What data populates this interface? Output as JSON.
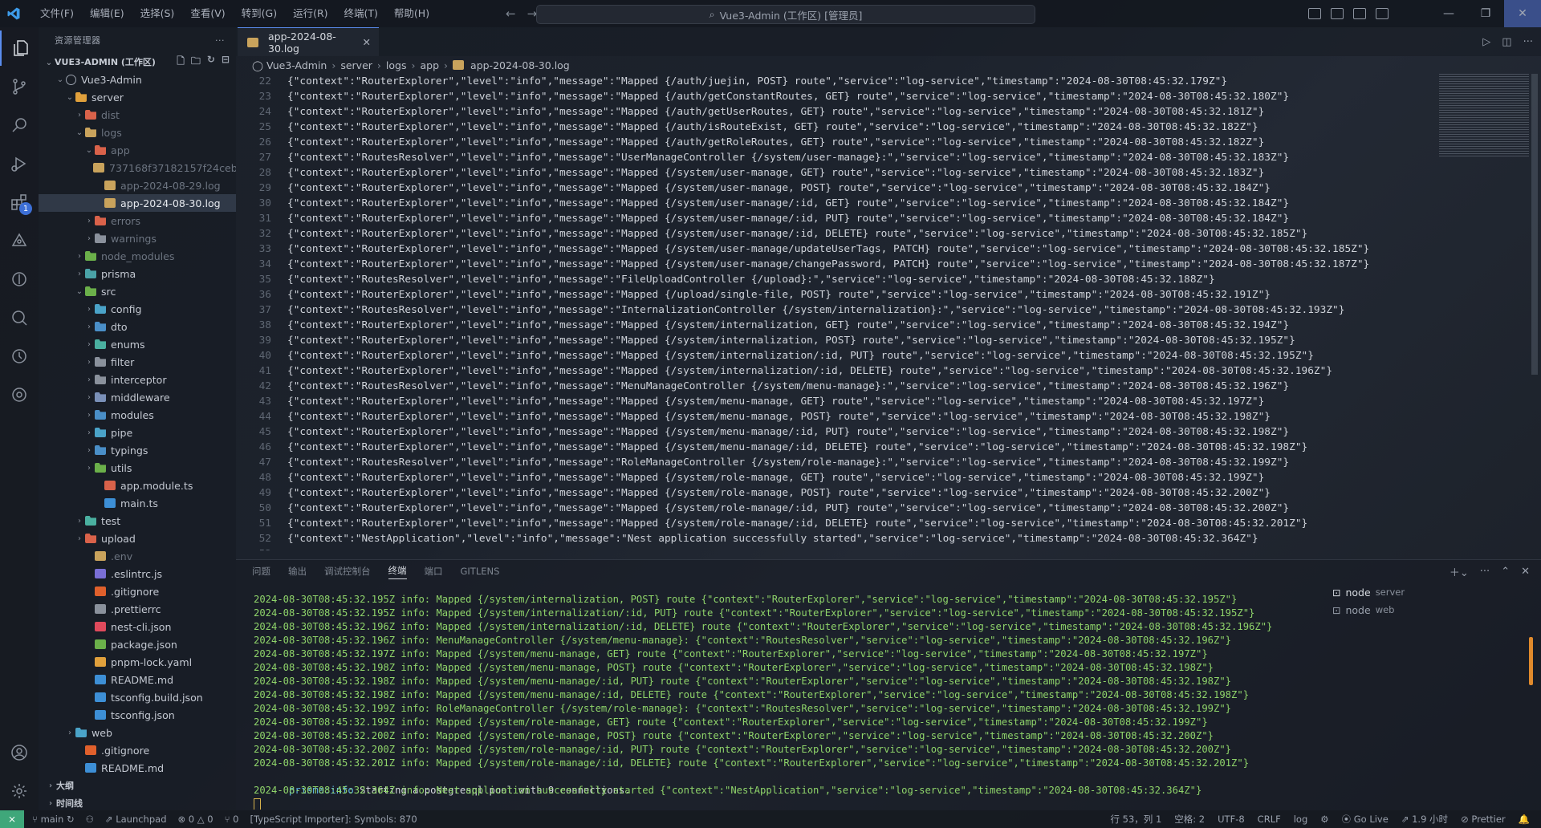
{
  "titlebar": {
    "menu": [
      "文件(F)",
      "编辑(E)",
      "选择(S)",
      "查看(V)",
      "转到(G)",
      "运行(R)",
      "终端(T)",
      "帮助(H)"
    ],
    "search": "Vue3-Admin (工作区) [管理员]"
  },
  "activity": {
    "extensions_badge": "1"
  },
  "sidebar": {
    "title": "资源管理器",
    "workspace": "VUE3-ADMIN (工作区)",
    "tree": [
      {
        "label": "Vue3-Admin",
        "indent": 1,
        "chev": "⌄",
        "icon": "circle",
        "color": "#9aa1ad",
        "dim": false,
        "sel": false
      },
      {
        "label": "server",
        "indent": 2,
        "chev": "⌄",
        "icon": "folder",
        "color": "#e0a03c",
        "dim": false,
        "sel": false
      },
      {
        "label": "dist",
        "indent": 3,
        "chev": "›",
        "icon": "folder",
        "color": "#d9624a",
        "dim": true,
        "sel": false
      },
      {
        "label": "logs",
        "indent": 3,
        "chev": "⌄",
        "icon": "folder",
        "color": "#c9a35c",
        "dim": true,
        "sel": false
      },
      {
        "label": "app",
        "indent": 4,
        "chev": "⌄",
        "icon": "folder",
        "color": "#d9624a",
        "dim": true,
        "sel": false
      },
      {
        "label": "737168f37182157f24ceb...",
        "indent": 5,
        "chev": "",
        "icon": "json",
        "color": "#c9a35c",
        "dim": true,
        "sel": false
      },
      {
        "label": "app-2024-08-29.log",
        "indent": 5,
        "chev": "",
        "icon": "log",
        "color": "#c9a35c",
        "dim": true,
        "sel": false
      },
      {
        "label": "app-2024-08-30.log",
        "indent": 5,
        "chev": "",
        "icon": "log",
        "color": "#c9a35c",
        "dim": false,
        "sel": true
      },
      {
        "label": "errors",
        "indent": 4,
        "chev": "›",
        "icon": "folder",
        "color": "#d9624a",
        "dim": true,
        "sel": false
      },
      {
        "label": "warnings",
        "indent": 4,
        "chev": "›",
        "icon": "folder",
        "color": "#8a919c",
        "dim": true,
        "sel": false
      },
      {
        "label": "node_modules",
        "indent": 3,
        "chev": "›",
        "icon": "folder",
        "color": "#6bb04a",
        "dim": true,
        "sel": false
      },
      {
        "label": "prisma",
        "indent": 3,
        "chev": "›",
        "icon": "folder",
        "color": "#4aa3a8",
        "dim": false,
        "sel": false
      },
      {
        "label": "src",
        "indent": 3,
        "chev": "⌄",
        "icon": "folder",
        "color": "#6bb04a",
        "dim": false,
        "sel": false
      },
      {
        "label": "config",
        "indent": 4,
        "chev": "›",
        "icon": "folder",
        "color": "#4aa3c8",
        "dim": false,
        "sel": false
      },
      {
        "label": "dto",
        "indent": 4,
        "chev": "›",
        "icon": "folder",
        "color": "#4a8fc8",
        "dim": false,
        "sel": false
      },
      {
        "label": "enums",
        "indent": 4,
        "chev": "›",
        "icon": "folder",
        "color": "#4ab0a0",
        "dim": false,
        "sel": false
      },
      {
        "label": "filter",
        "indent": 4,
        "chev": "›",
        "icon": "folder",
        "color": "#8a919c",
        "dim": false,
        "sel": false
      },
      {
        "label": "interceptor",
        "indent": 4,
        "chev": "›",
        "icon": "folder",
        "color": "#8a919c",
        "dim": false,
        "sel": false
      },
      {
        "label": "middleware",
        "indent": 4,
        "chev": "›",
        "icon": "folder",
        "color": "#7a90b8",
        "dim": false,
        "sel": false
      },
      {
        "label": "modules",
        "indent": 4,
        "chev": "›",
        "icon": "folder",
        "color": "#4a8fc8",
        "dim": false,
        "sel": false
      },
      {
        "label": "pipe",
        "indent": 4,
        "chev": "›",
        "icon": "folder",
        "color": "#4aa3c8",
        "dim": false,
        "sel": false
      },
      {
        "label": "typings",
        "indent": 4,
        "chev": "›",
        "icon": "folder",
        "color": "#4a8fc8",
        "dim": false,
        "sel": false
      },
      {
        "label": "utils",
        "indent": 4,
        "chev": "›",
        "icon": "folder",
        "color": "#6bb04a",
        "dim": false,
        "sel": false
      },
      {
        "label": "app.module.ts",
        "indent": 5,
        "chev": "",
        "icon": "file",
        "color": "#d9624a",
        "dim": false,
        "sel": false
      },
      {
        "label": "main.ts",
        "indent": 5,
        "chev": "",
        "icon": "file",
        "color": "#3d8fd6",
        "dim": false,
        "sel": false
      },
      {
        "label": "test",
        "indent": 3,
        "chev": "›",
        "icon": "folder",
        "color": "#4ab0a0",
        "dim": false,
        "sel": false
      },
      {
        "label": "upload",
        "indent": 3,
        "chev": "›",
        "icon": "folder",
        "color": "#d9624a",
        "dim": false,
        "sel": false
      },
      {
        "label": ".env",
        "indent": 4,
        "chev": "",
        "icon": "file",
        "color": "#c9a35c",
        "dim": true,
        "sel": false
      },
      {
        "label": ".eslintrc.js",
        "indent": 4,
        "chev": "",
        "icon": "file",
        "color": "#7a6fd6",
        "dim": false,
        "sel": false
      },
      {
        "label": ".gitignore",
        "indent": 4,
        "chev": "",
        "icon": "file",
        "color": "#e0602c",
        "dim": false,
        "sel": false
      },
      {
        "label": ".prettierrc",
        "indent": 4,
        "chev": "",
        "icon": "file",
        "color": "#8a919c",
        "dim": false,
        "sel": false
      },
      {
        "label": "nest-cli.json",
        "indent": 4,
        "chev": "",
        "icon": "file",
        "color": "#e04a5c",
        "dim": false,
        "sel": false
      },
      {
        "label": "package.json",
        "indent": 4,
        "chev": "",
        "icon": "file",
        "color": "#6bb04a",
        "dim": false,
        "sel": false
      },
      {
        "label": "pnpm-lock.yaml",
        "indent": 4,
        "chev": "",
        "icon": "file",
        "color": "#e0a03c",
        "dim": false,
        "sel": false
      },
      {
        "label": "README.md",
        "indent": 4,
        "chev": "",
        "icon": "file",
        "color": "#3d8fd6",
        "dim": false,
        "sel": false
      },
      {
        "label": "tsconfig.build.json",
        "indent": 4,
        "chev": "",
        "icon": "file",
        "color": "#3d8fd6",
        "dim": false,
        "sel": false
      },
      {
        "label": "tsconfig.json",
        "indent": 4,
        "chev": "",
        "icon": "file",
        "color": "#3d8fd6",
        "dim": false,
        "sel": false
      },
      {
        "label": "web",
        "indent": 2,
        "chev": "›",
        "icon": "folder",
        "color": "#4aa3c8",
        "dim": false,
        "sel": false
      },
      {
        "label": ".gitignore",
        "indent": 3,
        "chev": "",
        "icon": "file",
        "color": "#e0602c",
        "dim": false,
        "sel": false
      },
      {
        "label": "README.md",
        "indent": 3,
        "chev": "",
        "icon": "file",
        "color": "#3d8fd6",
        "dim": false,
        "sel": false
      },
      {
        "label": "大纲",
        "indent": 0,
        "chev": "›",
        "icon": "none",
        "color": "",
        "dim": false,
        "sel": false
      },
      {
        "label": "时间线",
        "indent": 0,
        "chev": "›",
        "icon": "none",
        "color": "",
        "dim": false,
        "sel": false
      }
    ]
  },
  "editor": {
    "tab": "app-2024-08-30.log",
    "breadcrumb": [
      "Vue3-Admin",
      "server",
      "logs",
      "app",
      "app-2024-08-30.log"
    ],
    "lines": [
      {
        "n": "22",
        "t": "{\"context\":\"RouterExplorer\",\"level\":\"info\",\"message\":\"Mapped {/auth/juejin, POST} route\",\"service\":\"log-service\",\"timestamp\":\"2024-08-30T08:45:32.179Z\"}"
      },
      {
        "n": "23",
        "t": "{\"context\":\"RouterExplorer\",\"level\":\"info\",\"message\":\"Mapped {/auth/getConstantRoutes, GET} route\",\"service\":\"log-service\",\"timestamp\":\"2024-08-30T08:45:32.180Z\"}"
      },
      {
        "n": "24",
        "t": "{\"context\":\"RouterExplorer\",\"level\":\"info\",\"message\":\"Mapped {/auth/getUserRoutes, GET} route\",\"service\":\"log-service\",\"timestamp\":\"2024-08-30T08:45:32.181Z\"}"
      },
      {
        "n": "25",
        "t": "{\"context\":\"RouterExplorer\",\"level\":\"info\",\"message\":\"Mapped {/auth/isRouteExist, GET} route\",\"service\":\"log-service\",\"timestamp\":\"2024-08-30T08:45:32.182Z\"}"
      },
      {
        "n": "26",
        "t": "{\"context\":\"RouterExplorer\",\"level\":\"info\",\"message\":\"Mapped {/auth/getRoleRoutes, GET} route\",\"service\":\"log-service\",\"timestamp\":\"2024-08-30T08:45:32.182Z\"}"
      },
      {
        "n": "27",
        "t": "{\"context\":\"RoutesResolver\",\"level\":\"info\",\"message\":\"UserManageController {/system/user-manage}:\",\"service\":\"log-service\",\"timestamp\":\"2024-08-30T08:45:32.183Z\"}"
      },
      {
        "n": "28",
        "t": "{\"context\":\"RouterExplorer\",\"level\":\"info\",\"message\":\"Mapped {/system/user-manage, GET} route\",\"service\":\"log-service\",\"timestamp\":\"2024-08-30T08:45:32.183Z\"}"
      },
      {
        "n": "29",
        "t": "{\"context\":\"RouterExplorer\",\"level\":\"info\",\"message\":\"Mapped {/system/user-manage, POST} route\",\"service\":\"log-service\",\"timestamp\":\"2024-08-30T08:45:32.184Z\"}"
      },
      {
        "n": "30",
        "t": "{\"context\":\"RouterExplorer\",\"level\":\"info\",\"message\":\"Mapped {/system/user-manage/:id, GET} route\",\"service\":\"log-service\",\"timestamp\":\"2024-08-30T08:45:32.184Z\"}"
      },
      {
        "n": "31",
        "t": "{\"context\":\"RouterExplorer\",\"level\":\"info\",\"message\":\"Mapped {/system/user-manage/:id, PUT} route\",\"service\":\"log-service\",\"timestamp\":\"2024-08-30T08:45:32.184Z\"}"
      },
      {
        "n": "32",
        "t": "{\"context\":\"RouterExplorer\",\"level\":\"info\",\"message\":\"Mapped {/system/user-manage/:id, DELETE} route\",\"service\":\"log-service\",\"timestamp\":\"2024-08-30T08:45:32.185Z\"}"
      },
      {
        "n": "33",
        "t": "{\"context\":\"RouterExplorer\",\"level\":\"info\",\"message\":\"Mapped {/system/user-manage/updateUserTags, PATCH} route\",\"service\":\"log-service\",\"timestamp\":\"2024-08-30T08:45:32.185Z\"}"
      },
      {
        "n": "34",
        "t": "{\"context\":\"RouterExplorer\",\"level\":\"info\",\"message\":\"Mapped {/system/user-manage/changePassword, PATCH} route\",\"service\":\"log-service\",\"timestamp\":\"2024-08-30T08:45:32.187Z\"}"
      },
      {
        "n": "35",
        "t": "{\"context\":\"RoutesResolver\",\"level\":\"info\",\"message\":\"FileUploadController {/upload}:\",\"service\":\"log-service\",\"timestamp\":\"2024-08-30T08:45:32.188Z\"}"
      },
      {
        "n": "36",
        "t": "{\"context\":\"RouterExplorer\",\"level\":\"info\",\"message\":\"Mapped {/upload/single-file, POST} route\",\"service\":\"log-service\",\"timestamp\":\"2024-08-30T08:45:32.191Z\"}"
      },
      {
        "n": "37",
        "t": "{\"context\":\"RoutesResolver\",\"level\":\"info\",\"message\":\"InternalizationController {/system/internalization}:\",\"service\":\"log-service\",\"timestamp\":\"2024-08-30T08:45:32.193Z\"}"
      },
      {
        "n": "38",
        "t": "{\"context\":\"RouterExplorer\",\"level\":\"info\",\"message\":\"Mapped {/system/internalization, GET} route\",\"service\":\"log-service\",\"timestamp\":\"2024-08-30T08:45:32.194Z\"}"
      },
      {
        "n": "39",
        "t": "{\"context\":\"RouterExplorer\",\"level\":\"info\",\"message\":\"Mapped {/system/internalization, POST} route\",\"service\":\"log-service\",\"timestamp\":\"2024-08-30T08:45:32.195Z\"}"
      },
      {
        "n": "40",
        "t": "{\"context\":\"RouterExplorer\",\"level\":\"info\",\"message\":\"Mapped {/system/internalization/:id, PUT} route\",\"service\":\"log-service\",\"timestamp\":\"2024-08-30T08:45:32.195Z\"}"
      },
      {
        "n": "41",
        "t": "{\"context\":\"RouterExplorer\",\"level\":\"info\",\"message\":\"Mapped {/system/internalization/:id, DELETE} route\",\"service\":\"log-service\",\"timestamp\":\"2024-08-30T08:45:32.196Z\"}"
      },
      {
        "n": "42",
        "t": "{\"context\":\"RoutesResolver\",\"level\":\"info\",\"message\":\"MenuManageController {/system/menu-manage}:\",\"service\":\"log-service\",\"timestamp\":\"2024-08-30T08:45:32.196Z\"}"
      },
      {
        "n": "43",
        "t": "{\"context\":\"RouterExplorer\",\"level\":\"info\",\"message\":\"Mapped {/system/menu-manage, GET} route\",\"service\":\"log-service\",\"timestamp\":\"2024-08-30T08:45:32.197Z\"}"
      },
      {
        "n": "44",
        "t": "{\"context\":\"RouterExplorer\",\"level\":\"info\",\"message\":\"Mapped {/system/menu-manage, POST} route\",\"service\":\"log-service\",\"timestamp\":\"2024-08-30T08:45:32.198Z\"}"
      },
      {
        "n": "45",
        "t": "{\"context\":\"RouterExplorer\",\"level\":\"info\",\"message\":\"Mapped {/system/menu-manage/:id, PUT} route\",\"service\":\"log-service\",\"timestamp\":\"2024-08-30T08:45:32.198Z\"}"
      },
      {
        "n": "46",
        "t": "{\"context\":\"RouterExplorer\",\"level\":\"info\",\"message\":\"Mapped {/system/menu-manage/:id, DELETE} route\",\"service\":\"log-service\",\"timestamp\":\"2024-08-30T08:45:32.198Z\"}"
      },
      {
        "n": "47",
        "t": "{\"context\":\"RoutesResolver\",\"level\":\"info\",\"message\":\"RoleManageController {/system/role-manage}:\",\"service\":\"log-service\",\"timestamp\":\"2024-08-30T08:45:32.199Z\"}"
      },
      {
        "n": "48",
        "t": "{\"context\":\"RouterExplorer\",\"level\":\"info\",\"message\":\"Mapped {/system/role-manage, GET} route\",\"service\":\"log-service\",\"timestamp\":\"2024-08-30T08:45:32.199Z\"}"
      },
      {
        "n": "49",
        "t": "{\"context\":\"RouterExplorer\",\"level\":\"info\",\"message\":\"Mapped {/system/role-manage, POST} route\",\"service\":\"log-service\",\"timestamp\":\"2024-08-30T08:45:32.200Z\"}"
      },
      {
        "n": "50",
        "t": "{\"context\":\"RouterExplorer\",\"level\":\"info\",\"message\":\"Mapped {/system/role-manage/:id, PUT} route\",\"service\":\"log-service\",\"timestamp\":\"2024-08-30T08:45:32.200Z\"}"
      },
      {
        "n": "51",
        "t": "{\"context\":\"RouterExplorer\",\"level\":\"info\",\"message\":\"Mapped {/system/role-manage/:id, DELETE} route\",\"service\":\"log-service\",\"timestamp\":\"2024-08-30T08:45:32.201Z\"}"
      },
      {
        "n": "52",
        "t": "{\"context\":\"NestApplication\",\"level\":\"info\",\"message\":\"Nest application successfully started\",\"service\":\"log-service\",\"timestamp\":\"2024-08-30T08:45:32.364Z\"}"
      },
      {
        "n": "53",
        "t": ""
      }
    ]
  },
  "panel": {
    "tabs": [
      "问题",
      "输出",
      "调试控制台",
      "终端",
      "端口",
      "GITLENS"
    ],
    "active_tab": "终端",
    "terminal_lines": [
      "2024-08-30T08:45:32.195Z info: Mapped {/system/internalization, POST} route {\"context\":\"RouterExplorer\",\"service\":\"log-service\",\"timestamp\":\"2024-08-30T08:45:32.195Z\"}",
      "2024-08-30T08:45:32.195Z info: Mapped {/system/internalization/:id, PUT} route {\"context\":\"RouterExplorer\",\"service\":\"log-service\",\"timestamp\":\"2024-08-30T08:45:32.195Z\"}",
      "2024-08-30T08:45:32.196Z info: Mapped {/system/internalization/:id, DELETE} route {\"context\":\"RouterExplorer\",\"service\":\"log-service\",\"timestamp\":\"2024-08-30T08:45:32.196Z\"}",
      "2024-08-30T08:45:32.196Z info: MenuManageController {/system/menu-manage}: {\"context\":\"RoutesResolver\",\"service\":\"log-service\",\"timestamp\":\"2024-08-30T08:45:32.196Z\"}",
      "2024-08-30T08:45:32.197Z info: Mapped {/system/menu-manage, GET} route {\"context\":\"RouterExplorer\",\"service\":\"log-service\",\"timestamp\":\"2024-08-30T08:45:32.197Z\"}",
      "2024-08-30T08:45:32.198Z info: Mapped {/system/menu-manage, POST} route {\"context\":\"RouterExplorer\",\"service\":\"log-service\",\"timestamp\":\"2024-08-30T08:45:32.198Z\"}",
      "2024-08-30T08:45:32.198Z info: Mapped {/system/menu-manage/:id, PUT} route {\"context\":\"RouterExplorer\",\"service\":\"log-service\",\"timestamp\":\"2024-08-30T08:45:32.198Z\"}",
      "2024-08-30T08:45:32.198Z info: Mapped {/system/menu-manage/:id, DELETE} route {\"context\":\"RouterExplorer\",\"service\":\"log-service\",\"timestamp\":\"2024-08-30T08:45:32.198Z\"}",
      "2024-08-30T08:45:32.199Z info: RoleManageController {/system/role-manage}: {\"context\":\"RoutesResolver\",\"service\":\"log-service\",\"timestamp\":\"2024-08-30T08:45:32.199Z\"}",
      "2024-08-30T08:45:32.199Z info: Mapped {/system/role-manage, GET} route {\"context\":\"RouterExplorer\",\"service\":\"log-service\",\"timestamp\":\"2024-08-30T08:45:32.199Z\"}",
      "2024-08-30T08:45:32.200Z info: Mapped {/system/role-manage, POST} route {\"context\":\"RouterExplorer\",\"service\":\"log-service\",\"timestamp\":\"2024-08-30T08:45:32.200Z\"}",
      "2024-08-30T08:45:32.200Z info: Mapped {/system/role-manage/:id, PUT} route {\"context\":\"RouterExplorer\",\"service\":\"log-service\",\"timestamp\":\"2024-08-30T08:45:32.200Z\"}",
      "2024-08-30T08:45:32.201Z info: Mapped {/system/role-manage/:id, DELETE} route {\"context\":\"RouterExplorer\",\"service\":\"log-service\",\"timestamp\":\"2024-08-30T08:45:32.201Z\"}"
    ],
    "prisma_prefix": "prisma:info",
    "prisma_text": " Starting a postgresql pool with 9 connections.",
    "last_line": "2024-08-30T08:45:32.364Z info: Nest application successfully started {\"context\":\"NestApplication\",\"service\":\"log-service\",\"timestamp\":\"2024-08-30T08:45:32.364Z\"}",
    "terminals": [
      {
        "name": "node",
        "sub": "server"
      },
      {
        "name": "node",
        "sub": "web"
      }
    ]
  },
  "statusbar": {
    "branch": "main",
    "launchpad": "Launchpad",
    "problems": "⊗ 0 △ 0",
    "ports": "⑂ 0",
    "ts": "[TypeScript Importer]: Symbols: 870",
    "position": "行 53，列 1",
    "spaces": "空格: 2",
    "encoding": "UTF-8",
    "eol": "CRLF",
    "lang": "log",
    "golive": "Go Live",
    "time": "1.9 小时",
    "prettier": "Prettier"
  }
}
